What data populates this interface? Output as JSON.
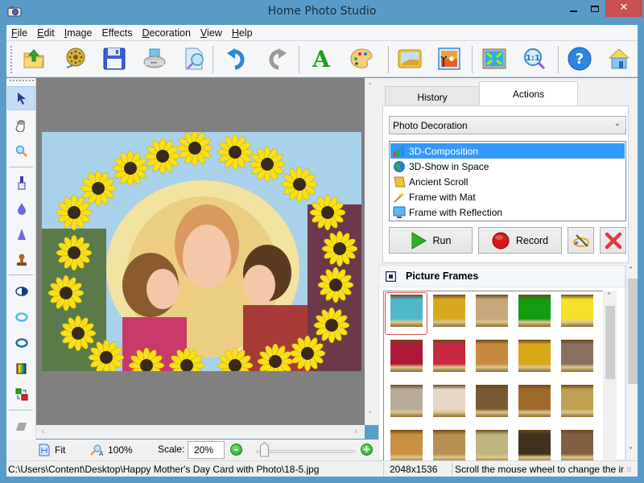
{
  "window": {
    "title": "Home Photo Studio",
    "controls": {
      "minimize": "–",
      "maximize": "☐",
      "close": "✕"
    }
  },
  "menu": [
    {
      "label": "File",
      "accel": "F",
      "rest": "ile"
    },
    {
      "label": "Edit",
      "accel": "E",
      "rest": "dit"
    },
    {
      "label": "Image",
      "accel": "I",
      "rest": "mage"
    },
    {
      "label": "Effects",
      "accel": "",
      "rest": "Effects"
    },
    {
      "label": "Decoration",
      "accel": "D",
      "rest": "ecoration"
    },
    {
      "label": "View",
      "accel": "V",
      "rest": "iew"
    },
    {
      "label": "Help",
      "accel": "H",
      "rest": "elp"
    }
  ],
  "toolbar": {
    "buttons": [
      "open-folder-icon",
      "film-reel-icon",
      "save-floppy-icon",
      "print-icon",
      "print-preview-icon",
      "undo-icon",
      "redo-icon",
      "text-icon",
      "palette-icon",
      "frame-icon",
      "photo-landscape-icon",
      "fit-screen-icon",
      "actual-size-icon",
      "help-icon",
      "home-icon"
    ],
    "actual_size_label": "1:1",
    "help_label": "?",
    "text_label": "A"
  },
  "left_tools": [
    "pointer-icon",
    "hand-icon",
    "zoom-icon",
    "brush-icon",
    "drop-icon",
    "cone-icon",
    "stamp-icon",
    "contrast-icon",
    "ring-light-icon",
    "ring-dark-icon",
    "color-balance-icon",
    "color-swap-icon",
    "eraser-icon"
  ],
  "tabs": {
    "history": "History",
    "actions": "Actions",
    "active": "actions"
  },
  "actions": {
    "category": "Photo Decoration",
    "items": [
      {
        "label": "3D-Composition",
        "icon": "chart-bars-icon",
        "selected": true
      },
      {
        "label": "3D-Show in Space",
        "icon": "globe-icon",
        "selected": false
      },
      {
        "label": "Ancient Scroll",
        "icon": "scroll-icon",
        "selected": false
      },
      {
        "label": "Frame with Mat",
        "icon": "magic-wand-icon",
        "selected": false
      },
      {
        "label": "Frame with Reflection",
        "icon": "monitor-icon",
        "selected": false
      }
    ],
    "run_label": "Run",
    "record_label": "Record"
  },
  "frames": {
    "title": "Picture Frames",
    "colors": [
      [
        "#4fb8c8",
        "#d8a820",
        "#c9a77a",
        "#119c11",
        "#f5e02a"
      ],
      [
        "#b01838",
        "#c82840",
        "#c88a40",
        "#d8a818",
        "#8a7060"
      ],
      [
        "#b8ac98",
        "#e8d8c8",
        "#7a5a30",
        "#a06828",
        "#c0a050"
      ],
      [
        "#c89040",
        "#b89050",
        "#c0b480",
        "#403020",
        "#806040"
      ]
    ],
    "selected_index": 0
  },
  "zoom_bar": {
    "fit_label": "Fit",
    "actual_label": "100%",
    "scale_label": "Scale:",
    "scale_value": "20%",
    "slider_fraction": 0.08
  },
  "status": {
    "path": "C:\\Users\\Content\\Desktop\\Happy Mother's Day Card with Photo\\18-5.jpg",
    "dimensions": "2048x1536",
    "hint": "Scroll the mouse wheel to change the ima"
  }
}
